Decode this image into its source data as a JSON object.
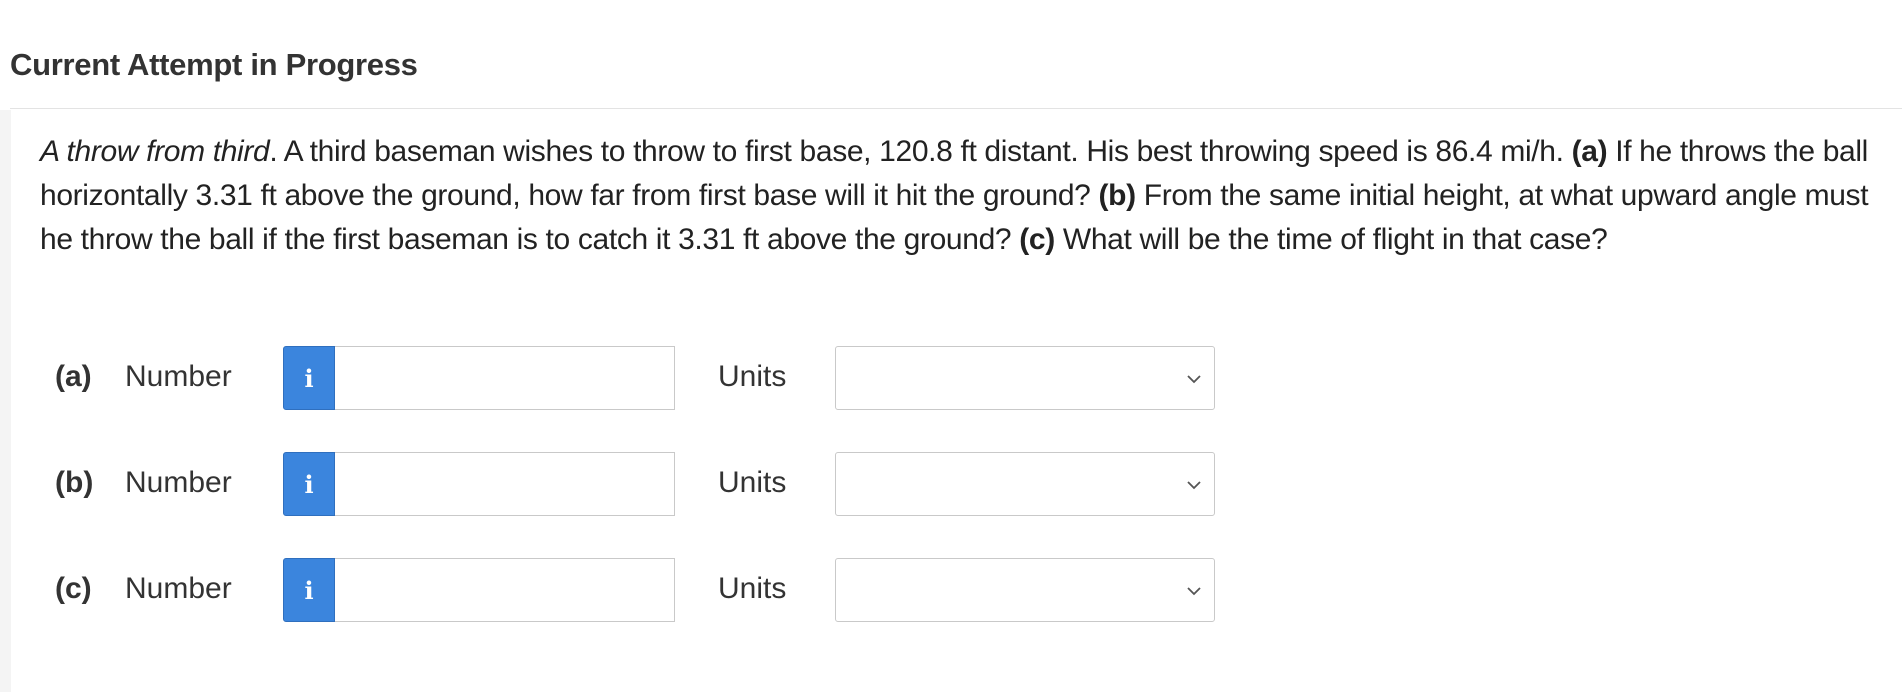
{
  "header": {
    "title": "Current Attempt in Progress"
  },
  "question": {
    "title_italic": "A throw from third",
    "intro": ". A third baseman wishes to throw to first base, 120.8 ft distant. His best throwing speed is 86.4 mi/h. ",
    "part_a_marker": "(a)",
    "part_a_text": " If he throws the ball horizontally 3.31 ft above the ground, how far from first base will it hit the ground? ",
    "part_b_marker": "(b)",
    "part_b_text": " From the same initial height, at what upward angle must he throw the ball if the first baseman is to catch it 3.31 ft above the ground? ",
    "part_c_marker": "(c)",
    "part_c_text": " What will be the time of flight in that case?"
  },
  "answers": [
    {
      "part": "(a)",
      "number_label": "Number",
      "info_glyph": "i",
      "number_value": "",
      "units_label": "Units",
      "units_selected": ""
    },
    {
      "part": "(b)",
      "number_label": "Number",
      "info_glyph": "i",
      "number_value": "",
      "units_label": "Units",
      "units_selected": ""
    },
    {
      "part": "(c)",
      "number_label": "Number",
      "info_glyph": "i",
      "number_value": "",
      "units_label": "Units",
      "units_selected": ""
    }
  ],
  "icons": {
    "info": "info-icon",
    "dropdown": "chevron-down-icon"
  },
  "colors": {
    "info_button": "#3b85dd",
    "text": "#222222",
    "border": "#c9c9c9"
  }
}
